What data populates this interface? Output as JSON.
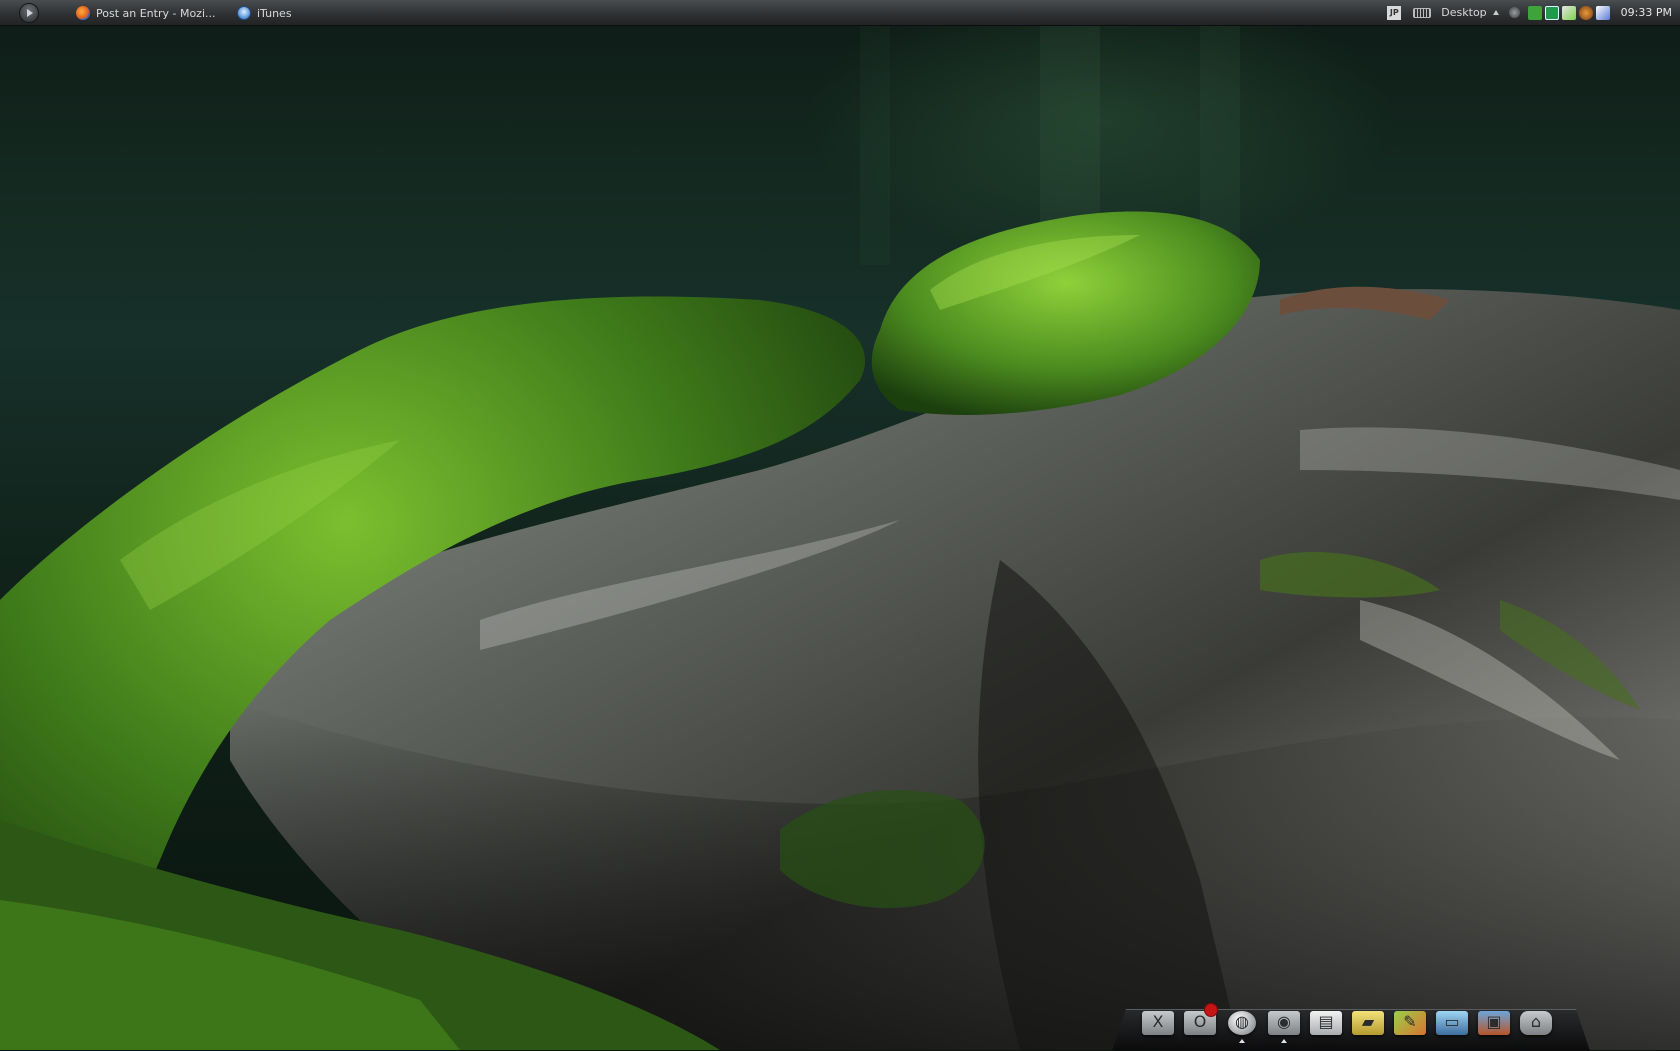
{
  "panel": {
    "tasks": [
      {
        "label": "Post an Entry - Mozi...",
        "icon": "firefox-icon"
      },
      {
        "label": "iTunes",
        "icon": "itunes-icon"
      }
    ],
    "tray": {
      "ime": "JP",
      "desktop_label": "Desktop",
      "clock": "09:33 PM"
    }
  },
  "dock": {
    "items": [
      {
        "name": "x11",
        "icon": "x11-icon",
        "glyph": "X"
      },
      {
        "name": "opera",
        "icon": "opera-icon",
        "glyph": "O"
      },
      {
        "name": "globe",
        "icon": "globe-icon",
        "glyph": "◍"
      },
      {
        "name": "media",
        "icon": "disc-icon",
        "glyph": "◉"
      },
      {
        "name": "document",
        "icon": "document-icon",
        "glyph": "▤"
      },
      {
        "name": "folder",
        "icon": "folder-icon",
        "glyph": "▰"
      },
      {
        "name": "paint",
        "icon": "paint-icon",
        "glyph": "✎"
      },
      {
        "name": "terminal",
        "icon": "terminal-icon",
        "glyph": "▭"
      },
      {
        "name": "photo",
        "icon": "photo-icon",
        "glyph": "▣"
      },
      {
        "name": "trash",
        "icon": "trash-icon",
        "glyph": "⌂"
      }
    ]
  },
  "colors": {
    "moss": "#4f8a1f",
    "bark": "#8a8c86",
    "panel": "#2f3133"
  }
}
